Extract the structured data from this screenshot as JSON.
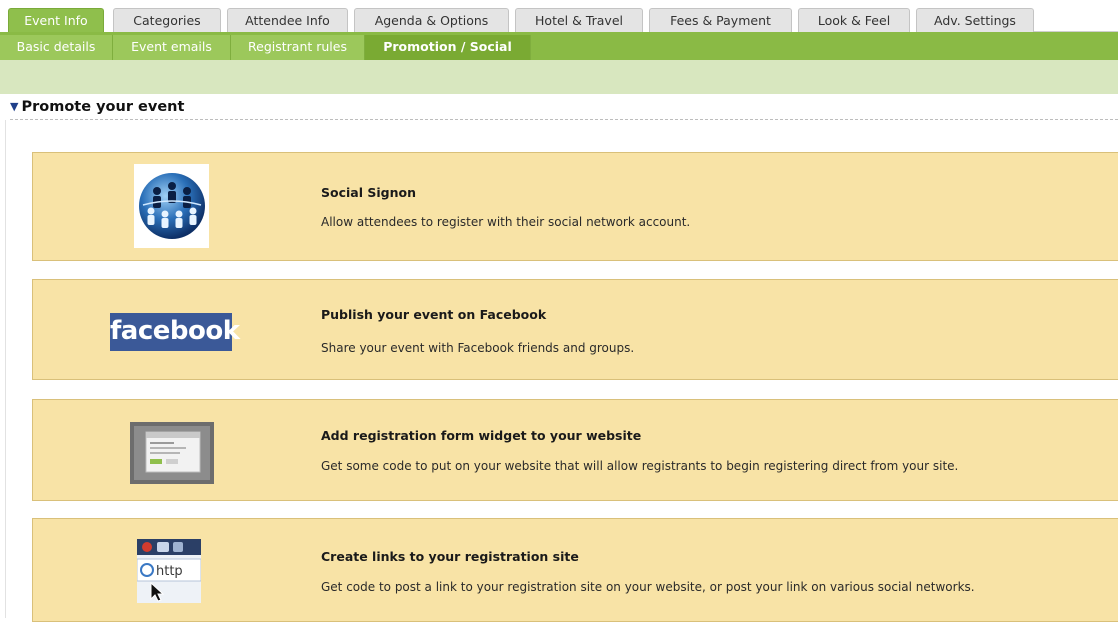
{
  "tabs": [
    {
      "label": "Event Info",
      "active": true
    },
    {
      "label": "Categories",
      "active": false
    },
    {
      "label": "Attendee Info",
      "active": false
    },
    {
      "label": "Agenda & Options",
      "active": false
    },
    {
      "label": "Hotel & Travel",
      "active": false
    },
    {
      "label": "Fees & Payment",
      "active": false
    },
    {
      "label": "Look & Feel",
      "active": false
    },
    {
      "label": "Adv. Settings",
      "active": false
    }
  ],
  "subtabs": [
    {
      "label": "Basic details",
      "active": false
    },
    {
      "label": "Event emails",
      "active": false
    },
    {
      "label": "Registrant rules",
      "active": false
    },
    {
      "label": "Promotion / Social",
      "active": true
    }
  ],
  "section": {
    "title": "Promote your event",
    "expanded": true
  },
  "cards": [
    {
      "icon": "social-network-globe-icon",
      "title": "Social Signon",
      "description": "Allow attendees to register with their social network account."
    },
    {
      "icon": "facebook-logo",
      "logo_text": "facebook",
      "title": "Publish your event on Facebook",
      "description": "Share your event with Facebook friends and groups."
    },
    {
      "icon": "widget-screenshot-icon",
      "title": "Add registration form widget to your website",
      "description": "Get some code to put on your website that will allow registrants to begin registering direct from your site."
    },
    {
      "icon": "browser-link-icon",
      "link_text": "http",
      "title": "Create links to your registration site",
      "description": "Get code to post a link to your registration site on your website, or post your link on various social networks."
    }
  ],
  "colors": {
    "active_tab": "#8fbf4c",
    "subtab_bar": "#8aba45",
    "card_background": "#f8e3a6",
    "facebook_blue": "#3b5998"
  }
}
